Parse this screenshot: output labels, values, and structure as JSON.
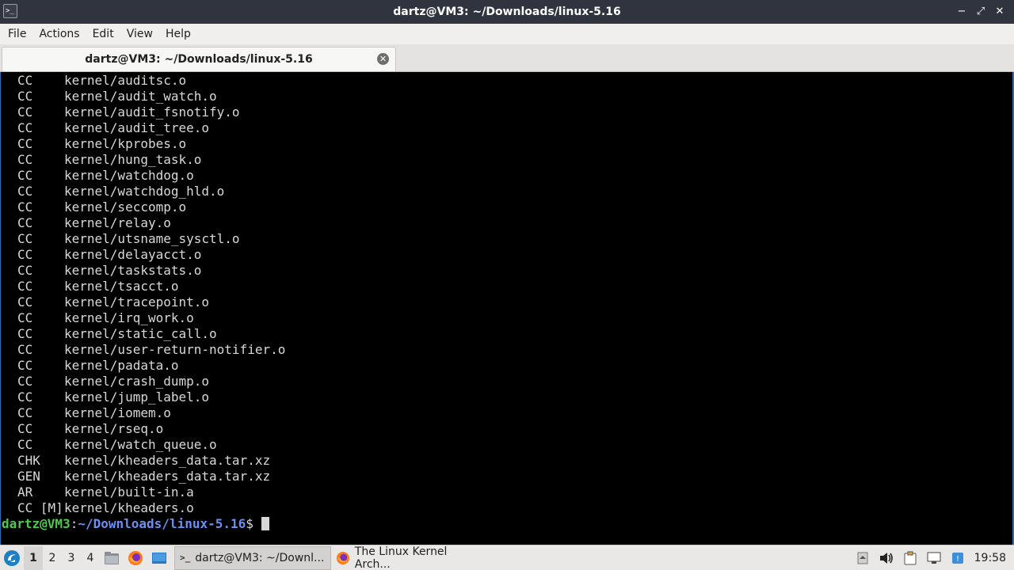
{
  "window": {
    "title": "dartz@VM3: ~/Downloads/linux-5.16",
    "controls": {
      "minimize": "−",
      "maximize": "⤢",
      "close": "✕"
    }
  },
  "menu": [
    "File",
    "Actions",
    "Edit",
    "View",
    "Help"
  ],
  "tab": {
    "label": "dartz@VM3: ~/Downloads/linux-5.16",
    "close": "✕"
  },
  "terminal": {
    "lines": [
      {
        "tag": "CC",
        "path": "kernel/auditsc.o"
      },
      {
        "tag": "CC",
        "path": "kernel/audit_watch.o"
      },
      {
        "tag": "CC",
        "path": "kernel/audit_fsnotify.o"
      },
      {
        "tag": "CC",
        "path": "kernel/audit_tree.o"
      },
      {
        "tag": "CC",
        "path": "kernel/kprobes.o"
      },
      {
        "tag": "CC",
        "path": "kernel/hung_task.o"
      },
      {
        "tag": "CC",
        "path": "kernel/watchdog.o"
      },
      {
        "tag": "CC",
        "path": "kernel/watchdog_hld.o"
      },
      {
        "tag": "CC",
        "path": "kernel/seccomp.o"
      },
      {
        "tag": "CC",
        "path": "kernel/relay.o"
      },
      {
        "tag": "CC",
        "path": "kernel/utsname_sysctl.o"
      },
      {
        "tag": "CC",
        "path": "kernel/delayacct.o"
      },
      {
        "tag": "CC",
        "path": "kernel/taskstats.o"
      },
      {
        "tag": "CC",
        "path": "kernel/tsacct.o"
      },
      {
        "tag": "CC",
        "path": "kernel/tracepoint.o"
      },
      {
        "tag": "CC",
        "path": "kernel/irq_work.o"
      },
      {
        "tag": "CC",
        "path": "kernel/static_call.o"
      },
      {
        "tag": "CC",
        "path": "kernel/user-return-notifier.o"
      },
      {
        "tag": "CC",
        "path": "kernel/padata.o"
      },
      {
        "tag": "CC",
        "path": "kernel/crash_dump.o"
      },
      {
        "tag": "CC",
        "path": "kernel/jump_label.o"
      },
      {
        "tag": "CC",
        "path": "kernel/iomem.o"
      },
      {
        "tag": "CC",
        "path": "kernel/rseq.o"
      },
      {
        "tag": "CC",
        "path": "kernel/watch_queue.o"
      },
      {
        "tag": "CHK",
        "path": "kernel/kheaders_data.tar.xz"
      },
      {
        "tag": "GEN",
        "path": "kernel/kheaders_data.tar.xz"
      },
      {
        "tag": "AR",
        "path": "kernel/built-in.a"
      },
      {
        "tag": "CC [M]",
        "path": "kernel/kheaders.o"
      }
    ],
    "prompt": {
      "user_host": "dartz@VM3",
      "colon": ":",
      "dir": "~/Downloads/linux-5.16",
      "symbol": "$"
    }
  },
  "taskbar": {
    "workspaces": [
      "1",
      "2",
      "3",
      "4"
    ],
    "tasks": [
      {
        "label": "dartz@VM3: ~/Downl...",
        "icon": "terminal-icon"
      },
      {
        "label": "The Linux Kernel Arch...",
        "icon": "firefox-icon"
      }
    ],
    "clock": "19:58"
  },
  "colors": {
    "titlebar": "#2f343f",
    "prompt_user": "#4ec94e",
    "prompt_dir": "#6d8ef2",
    "terminal_bg": "#000000",
    "terminal_fg": "#d8d8d8"
  }
}
